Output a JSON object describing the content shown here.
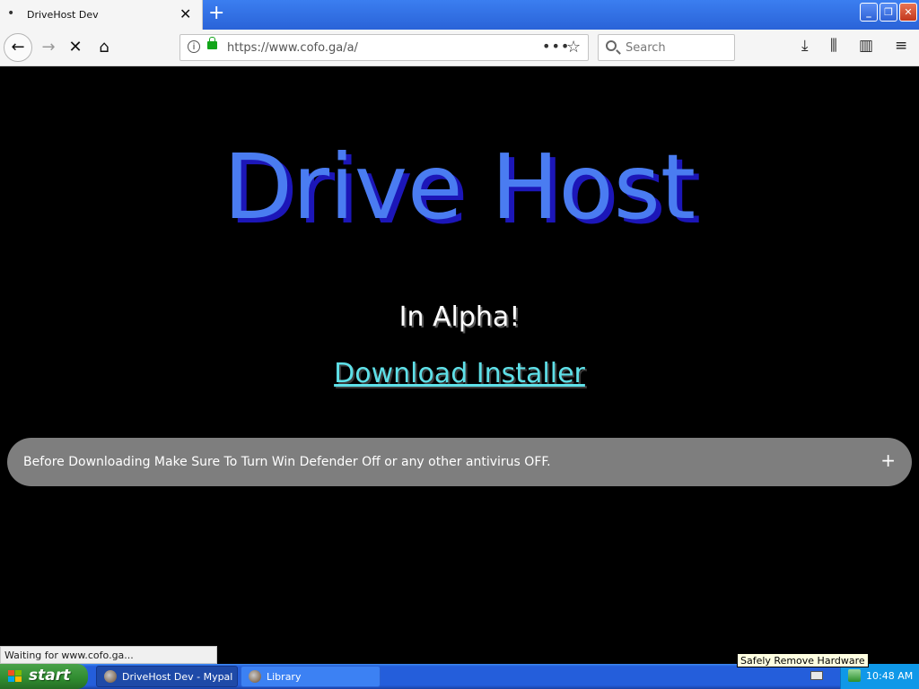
{
  "browser": {
    "tab": {
      "title": "DriveHost Dev",
      "close": "✕"
    },
    "new_tab": "+",
    "window_buttons": {
      "minimize": "_",
      "restore": "❐",
      "close": "✕"
    },
    "nav": {
      "back": "←",
      "forward": "→",
      "stop": "✕",
      "home": "⌂"
    },
    "address": {
      "url": "https://www.cofo.ga/a/",
      "info": "i",
      "page_actions": "•••",
      "bookmark": "☆"
    },
    "search": {
      "placeholder": "Search"
    },
    "toolbar": {
      "downloads": "⤓",
      "library": "⫼",
      "sidebar": "▥",
      "menu": "≡"
    },
    "status": "Waiting for www.cofo.ga..."
  },
  "page": {
    "heading": "Drive Host",
    "subtitle": "In Alpha!",
    "download_link": "Download Installer",
    "notice": "Before Downloading Make Sure To Turn Win Defender Off or any other antivirus OFF.",
    "notice_toggle": "+",
    "colors": {
      "heading": "#4a7cf1",
      "heading_shadow": "#1c16b8",
      "link": "#5ee0e8",
      "notice_bg": "#7e7e7e"
    }
  },
  "taskbar": {
    "start": "start",
    "tasks": [
      {
        "label": "DriveHost Dev - Mypal",
        "active": true
      },
      {
        "label": "Library",
        "active": false
      }
    ],
    "tooltip": "Safely Remove Hardware",
    "clock": "10:48 AM"
  }
}
